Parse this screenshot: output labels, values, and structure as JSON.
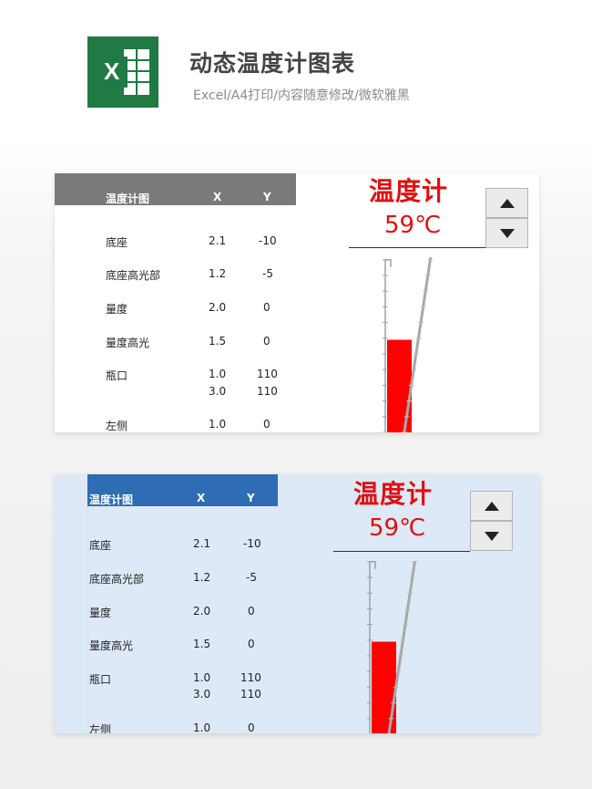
{
  "header": {
    "title": "动态温度计图表",
    "subtitle": "Excel/A4打印/内容随意修改/微软雅黑"
  },
  "logo": {
    "icon": "excel-icon",
    "letter": "X",
    "color": "#1f7a44"
  },
  "table": {
    "headers": [
      "温度计图",
      "X",
      "Y"
    ],
    "rows": [
      {
        "label": "底座",
        "x": "2.1",
        "y": "-10"
      },
      {
        "label": "底座高光部",
        "x": "1.2",
        "y": "-5"
      },
      {
        "label": "量度",
        "x": "2.0",
        "y": "0"
      },
      {
        "label": "量度高光",
        "x": "1.5",
        "y": "0"
      },
      {
        "label": "瓶口",
        "x": "1.0",
        "y": "110"
      },
      {
        "label": "",
        "x": "3.0",
        "y": "110"
      },
      {
        "label": "左侧",
        "x": "1.0",
        "y": "0"
      }
    ]
  },
  "gauge": {
    "label": "温度计",
    "value_text": "59℃",
    "value": 59,
    "max": 110,
    "fill_color": "#ff0000",
    "accent_color": "#e01010"
  },
  "spinner": {
    "up_icon": "triangle-up-icon",
    "down_icon": "triangle-down-icon"
  },
  "cards": {
    "card1_bg": "#ffffff",
    "card1_header": "#7a7a7a",
    "card2_bg": "#dde9f7",
    "card2_header": "#2e6db4"
  }
}
